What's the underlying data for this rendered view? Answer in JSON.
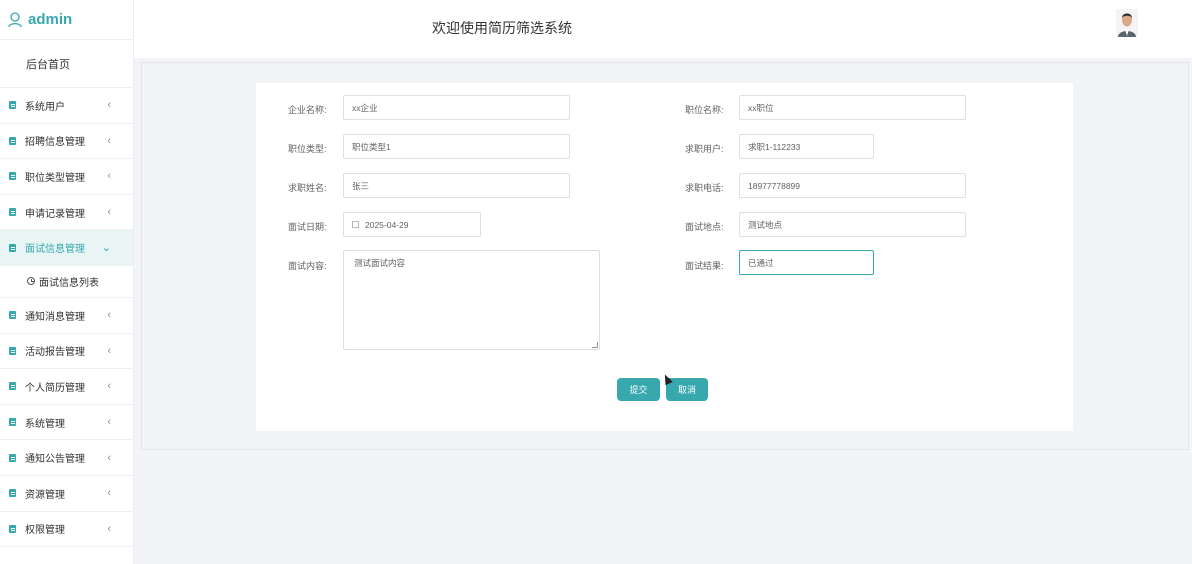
{
  "sidebar": {
    "brand": "admin",
    "home": "后台首页",
    "items": [
      {
        "label": "系统用户"
      },
      {
        "label": "招聘信息管理"
      },
      {
        "label": "职位类型管理"
      },
      {
        "label": "申请记录管理"
      },
      {
        "label": "面试信息管理",
        "active": true
      },
      {
        "label": "通知消息管理"
      },
      {
        "label": "活动报告管理"
      },
      {
        "label": "个人简历管理"
      },
      {
        "label": "系统管理"
      },
      {
        "label": "通知公告管理"
      },
      {
        "label": "资源管理"
      },
      {
        "label": "权限管理"
      }
    ],
    "submenu": {
      "label": "面试信息列表"
    },
    "arrow_collapsed": "‹",
    "arrow_expanded": "⌄"
  },
  "header": {
    "title": "欢迎使用简历筛选系统"
  },
  "form": {
    "company_label": "企业名称:",
    "company_value": "xx企业",
    "position_label": "职位名称:",
    "position_value": "xx职位",
    "type_label": "职位类型:",
    "type_value": "职位类型1",
    "user_label": "求职用户:",
    "user_value": "求职1-112233",
    "name_label": "求职姓名:",
    "name_value": "张三",
    "phone_label": "求职电话:",
    "phone_value": "18977778899",
    "date_label": "面试日期:",
    "date_value": "2025-04-29",
    "location_label": "面试地点:",
    "location_value": "测试地点",
    "content_label": "面试内容:",
    "content_value": "测试面试内容",
    "result_label": "面试结果:",
    "result_value": "已通过",
    "submit": "提交",
    "cancel": "取消"
  },
  "colors": {
    "accent": "#36a8ae",
    "active_bg": "#e9f4f5"
  }
}
